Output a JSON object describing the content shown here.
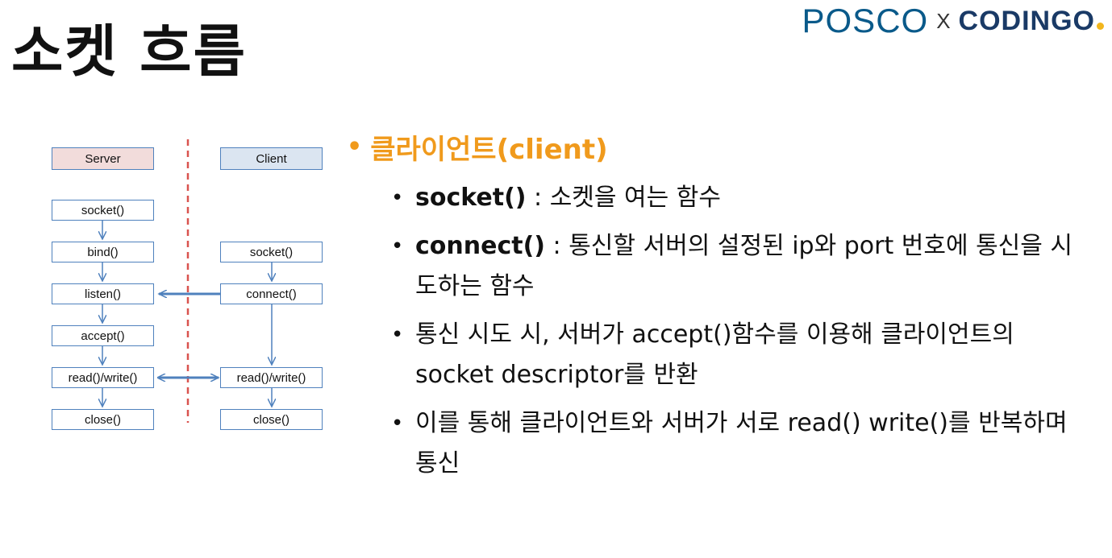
{
  "page": {
    "title": "소켓 흐름"
  },
  "logo": {
    "posco": "POSCO",
    "x": "X",
    "coding": "CODINGO"
  },
  "diagram": {
    "server_header": "Server",
    "client_header": "Client",
    "server_steps": [
      "socket()",
      "bind()",
      "listen()",
      "accept()",
      "read()/write()",
      "close()"
    ],
    "client_steps": [
      "socket()",
      "connect()",
      "read()/write()",
      "close()"
    ],
    "colors": {
      "server_header": "#f2dcdb",
      "client_header": "#dbe5f1",
      "divider": "#d9534f",
      "arrow": "#4f81bd"
    }
  },
  "content": {
    "heading": "클라이언트(client)",
    "heading_color": "#f09a1c",
    "items": [
      {
        "keyword": "socket()",
        "text": " : 소켓을 여는 함수"
      },
      {
        "keyword": "connect()",
        "text": " : 통신할 서버의 설정된 ip와 port 번호에 통신을 시도하는 함수"
      },
      {
        "keyword": "",
        "text": "통신 시도 시, 서버가 accept()함수를 이용해 클라이언트의 socket descriptor를 반환"
      },
      {
        "keyword": "",
        "text": "이를 통해 클라이언트와 서버가 서로 read() write()를 반복하며 통신"
      }
    ]
  }
}
